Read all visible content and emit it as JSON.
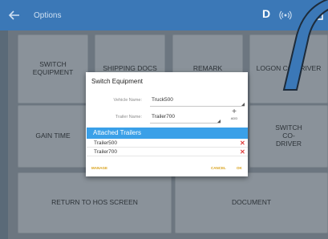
{
  "appbar": {
    "title": "Options",
    "badge": "D",
    "color": "#3b78b7"
  },
  "tiles": [
    {
      "label": "SWITCH EQUIPMENT"
    },
    {
      "label": "SHIPPING DOCS"
    },
    {
      "label": "REMARK"
    },
    {
      "label": "LOGON CO-DRIVER"
    },
    {
      "label": "GAIN TIME"
    },
    {
      "label": "SWITCH CO-DRIVER"
    },
    {
      "label": "RETURN TO HOS SCREEN"
    },
    {
      "label": "DOCUMENT"
    }
  ],
  "dialog": {
    "title": "Switch Equipment",
    "vehicle_label": "Vehicle Name:",
    "vehicle_value": "Truck500",
    "trailer_label": "Trailer Name:",
    "trailer_value": "Trailer700",
    "add_label": "ADD",
    "attached_header": "Attached Trailers",
    "attached": [
      {
        "name": "Trailer500"
      },
      {
        "name": "Trailer700"
      }
    ],
    "remove_icon": "✕",
    "manage_label": "MANAGE",
    "cancel_label": "CANCEL",
    "ok_label": "OK",
    "header_color": "#3aa0e8",
    "action_color": "#d9a21b",
    "remove_color": "#e04040"
  }
}
